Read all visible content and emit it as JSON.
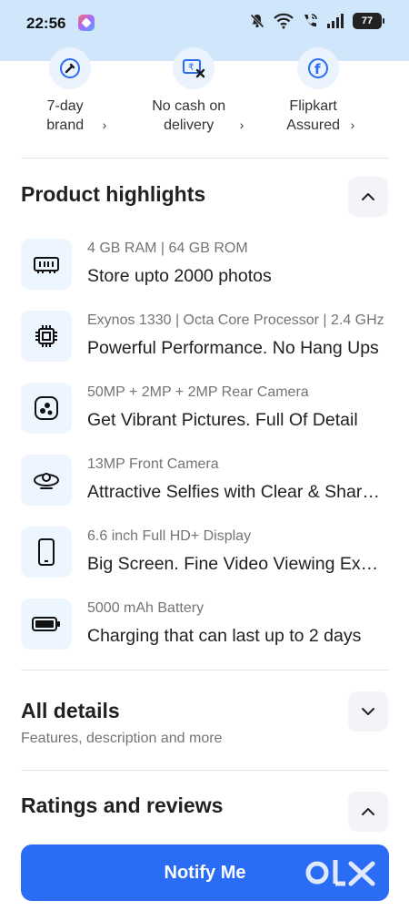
{
  "status_bar": {
    "time": "22:56",
    "battery": "77"
  },
  "assurances": [
    {
      "icon": "brand-warranty-icon",
      "label": "7-day brand"
    },
    {
      "icon": "no-cash-icon",
      "label": "No cash on delivery"
    },
    {
      "icon": "flipkart-assured-icon",
      "label": "Flipkart Assured"
    }
  ],
  "highlights": {
    "title": "Product highlights",
    "items": [
      {
        "icon": "memory-icon",
        "sub": "4 GB RAM | 64 GB ROM",
        "main": "Store upto 2000 photos"
      },
      {
        "icon": "processor-icon",
        "sub": "Exynos 1330 | Octa Core Processor | 2.4 GHz",
        "main": "Powerful Performance. No Hang Ups"
      },
      {
        "icon": "rear-camera-icon",
        "sub": "50MP + 2MP + 2MP Rear Camera",
        "main": "Get Vibrant Pictures. Full Of Detail"
      },
      {
        "icon": "front-camera-icon",
        "sub": "13MP Front Camera",
        "main": "Attractive Selfies with Clear & Sharp Details"
      },
      {
        "icon": "display-icon",
        "sub": "6.6 inch Full HD+ Display",
        "main": "Big Screen. Fine Video Viewing Experience"
      },
      {
        "icon": "battery-icon",
        "sub": "5000 mAh Battery",
        "main": "Charging that can last up to 2 days"
      }
    ]
  },
  "all_details": {
    "title": "All details",
    "subtitle": "Features, description and more"
  },
  "ratings": {
    "title": "Ratings and reviews"
  },
  "notify_button": {
    "label": "Notify Me"
  },
  "watermark": "OLX",
  "colors": {
    "accent": "#2a6df4",
    "status_bar": "#cfe6fb",
    "icon_bg": "#edf5fe"
  }
}
